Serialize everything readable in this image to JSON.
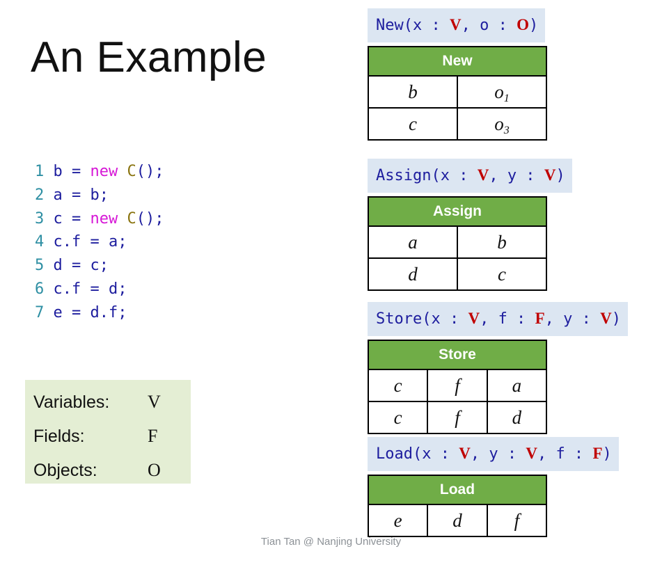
{
  "slide": {
    "title": "An Example",
    "footer": "Tian Tan @ Nanjing University"
  },
  "code": {
    "lines": [
      {
        "num": "1",
        "tokens": [
          {
            "t": "b = ",
            "c": "id"
          },
          {
            "t": "new ",
            "c": "kw"
          },
          {
            "t": "C",
            "c": "type"
          },
          {
            "t": "();",
            "c": "id"
          }
        ]
      },
      {
        "num": "2",
        "tokens": [
          {
            "t": "a = b;",
            "c": "id"
          }
        ]
      },
      {
        "num": "3",
        "tokens": [
          {
            "t": "c = ",
            "c": "id"
          },
          {
            "t": "new ",
            "c": "kw"
          },
          {
            "t": "C",
            "c": "type"
          },
          {
            "t": "();",
            "c": "id"
          }
        ]
      },
      {
        "num": "4",
        "tokens": [
          {
            "t": "c.f = a;",
            "c": "id"
          }
        ]
      },
      {
        "num": "5",
        "tokens": [
          {
            "t": "d = c;",
            "c": "id"
          }
        ]
      },
      {
        "num": "6",
        "tokens": [
          {
            "t": "c.f = d;",
            "c": "id"
          }
        ]
      },
      {
        "num": "7",
        "tokens": [
          {
            "t": "e = d.f;",
            "c": "id"
          }
        ]
      }
    ]
  },
  "legend": {
    "rows": [
      {
        "label": "Variables:",
        "symbol": "V"
      },
      {
        "label": "Fields:",
        "symbol": "F"
      },
      {
        "label": "Objects:",
        "symbol": "O"
      }
    ]
  },
  "rules": [
    {
      "id": "new",
      "signature": [
        {
          "t": "New(x : ",
          "red": false
        },
        {
          "t": "V",
          "red": true
        },
        {
          "t": ", o : ",
          "red": false
        },
        {
          "t": "O",
          "red": true
        },
        {
          "t": ")",
          "red": false
        }
      ],
      "header": "New",
      "columns": 2,
      "rows": [
        [
          {
            "base": "b",
            "sub": ""
          },
          {
            "base": "o",
            "sub": "1"
          }
        ],
        [
          {
            "base": "c",
            "sub": ""
          },
          {
            "base": "o",
            "sub": "3"
          }
        ]
      ]
    },
    {
      "id": "assign",
      "signature": [
        {
          "t": "Assign(x : ",
          "red": false
        },
        {
          "t": "V",
          "red": true
        },
        {
          "t": ", y : ",
          "red": false
        },
        {
          "t": "V",
          "red": true
        },
        {
          "t": ")",
          "red": false
        }
      ],
      "header": "Assign",
      "columns": 2,
      "rows": [
        [
          {
            "base": "a",
            "sub": ""
          },
          {
            "base": "b",
            "sub": ""
          }
        ],
        [
          {
            "base": "d",
            "sub": ""
          },
          {
            "base": "c",
            "sub": ""
          }
        ]
      ]
    },
    {
      "id": "store",
      "signature": [
        {
          "t": "Store(x : ",
          "red": false
        },
        {
          "t": "V",
          "red": true
        },
        {
          "t": ", f : ",
          "red": false
        },
        {
          "t": "F",
          "red": true
        },
        {
          "t": ", y : ",
          "red": false
        },
        {
          "t": "V",
          "red": true
        },
        {
          "t": ")",
          "red": false
        }
      ],
      "header": "Store",
      "columns": 3,
      "rows": [
        [
          {
            "base": "c",
            "sub": ""
          },
          {
            "base": "f",
            "sub": ""
          },
          {
            "base": "a",
            "sub": ""
          }
        ],
        [
          {
            "base": "c",
            "sub": ""
          },
          {
            "base": "f",
            "sub": ""
          },
          {
            "base": "d",
            "sub": ""
          }
        ]
      ]
    },
    {
      "id": "load",
      "signature": [
        {
          "t": "Load(x : ",
          "red": false
        },
        {
          "t": "V",
          "red": true
        },
        {
          "t": ", y : ",
          "red": false
        },
        {
          "t": "V",
          "red": true
        },
        {
          "t": ", f : ",
          "red": false
        },
        {
          "t": "F",
          "red": true
        },
        {
          "t": ")",
          "red": false
        }
      ],
      "header": "Load",
      "columns": 3,
      "rows": [
        [
          {
            "base": "e",
            "sub": ""
          },
          {
            "base": "d",
            "sub": ""
          },
          {
            "base": "f",
            "sub": ""
          }
        ]
      ]
    }
  ],
  "colors": {
    "table_header_green": "#70ad47",
    "signature_bar_blue": "#dce6f2",
    "legend_box_green": "#e4eed4",
    "signature_text_blue": "#1d1d9e",
    "signature_red": "#c00000",
    "code_linenum": "#2e8fa3",
    "code_keyword": "#d617d6",
    "code_type": "#8a7410",
    "footer_gray": "#8c9196"
  }
}
